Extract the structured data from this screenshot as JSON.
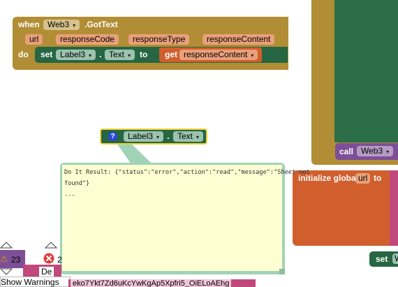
{
  "event_block": {
    "when": "when",
    "component": "Web3",
    "event": ".GotText",
    "params": [
      "url",
      "responseCode",
      "responseType",
      "responseContent"
    ],
    "do": "do",
    "set": "set",
    "target": "Label3",
    "dot": ".",
    "property": "Text",
    "to": "to",
    "get": "get",
    "get_var": "responseContent"
  },
  "floating_block": {
    "component": "Label3",
    "dot": ".",
    "property": "Text",
    "help": "?"
  },
  "do_it_bubble": {
    "line1": "Do It Result: {\"status\":\"error\",\"action\":\"read\",\"message\":\"Sheet not",
    "line2": "found\"}",
    "line3": "---"
  },
  "call_block": {
    "call": "call",
    "component": "Web3"
  },
  "init_global": {
    "label": "initialize global",
    "var": "url",
    "to": "to"
  },
  "set_block_partial": {
    "label": "set",
    "component": "W"
  },
  "warnings": {
    "warn_count": "23",
    "err_count": "2",
    "toggle_label": "Show Warnings",
    "dismiss_partial": "De",
    "url_partial": "eko7Ykt7Zd6uKcYwKgAp5Xpfri5_OiELoAEhg"
  },
  "colors": {
    "event_gold": "#b18e35",
    "setter_green": "#266643",
    "getter_orange": "#d05f2d",
    "param_orange": "#e9a07a",
    "procedure_purple": "#7d4f97",
    "tooltip_yellow": "#fefed3",
    "tooltip_border": "#a0d3b5",
    "blue_help": "#2a4bd6",
    "dark_green_canvas": "#2c6e47"
  }
}
